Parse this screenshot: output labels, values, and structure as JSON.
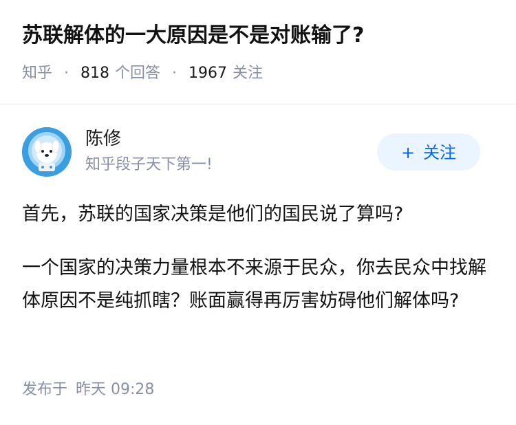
{
  "question": {
    "title": "苏联解体的一大原因是不是对账输了?",
    "source": "知乎",
    "answers_count": "818",
    "answers_label": "个回答",
    "followers_count": "1967",
    "followers_label": "关注",
    "separator": "·"
  },
  "author": {
    "name": "陈修",
    "bio": "知乎段子天下第一!",
    "avatar_icon": "dog-astronaut-avatar",
    "follow_plus": "+",
    "follow_label": "关注"
  },
  "answer": {
    "paragraphs": [
      "首先，苏联的国家决策是他们的国民说了算吗?",
      "一个国家的决策力量根本不来源于民众，你去民众中找解体原因不是纯抓瞎？账面赢得再厉害妨碍他们解体吗?"
    ],
    "publish_label": "发布于",
    "publish_time": "昨天 09:28"
  },
  "colors": {
    "accent": "#0066ff",
    "follow_bg": "#ebf5ff",
    "meta_gray": "#8590a6",
    "avatar_blue": "#3a9ee0"
  }
}
